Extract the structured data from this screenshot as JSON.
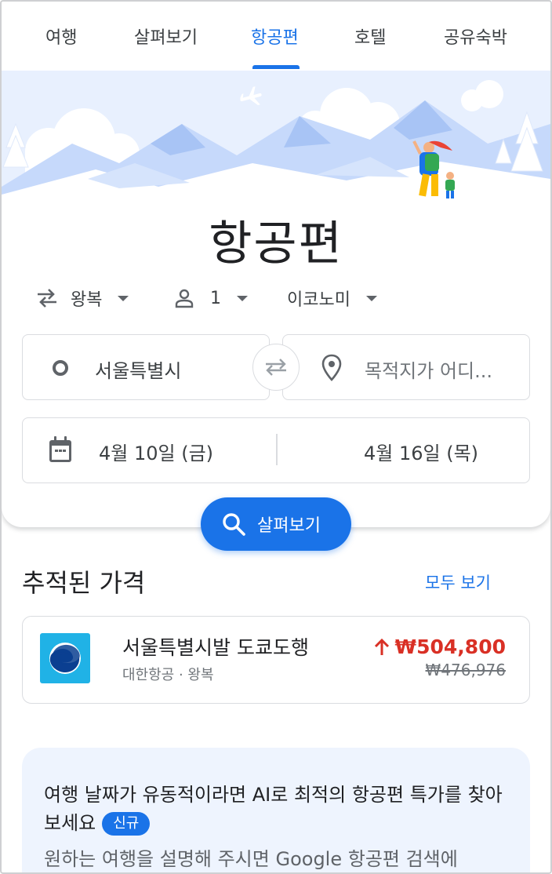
{
  "tabs": [
    {
      "label": "여행"
    },
    {
      "label": "살펴보기"
    },
    {
      "label": "항공편"
    },
    {
      "label": "호텔"
    },
    {
      "label": "공유숙박"
    }
  ],
  "active_tab": "항공편",
  "page_title": "항공편",
  "options": {
    "trip_type": "왕복",
    "passengers": "1",
    "cabin_class": "이코노미"
  },
  "origin": {
    "value": "서울특별시"
  },
  "destination": {
    "placeholder": "목적지가 어디..."
  },
  "dates": {
    "depart": "4월 10일 (금)",
    "return": "4월 16일 (목)"
  },
  "search_button": {
    "label": "살펴보기"
  },
  "tracked": {
    "title": "추적된 가격",
    "see_all": "모두 보기",
    "items": [
      {
        "route": "서울특별시발 도쿄도행",
        "airline": "대한항공 · 왕복",
        "price": "₩504,800",
        "old_price": "₩476,976",
        "trend": "up"
      }
    ]
  },
  "ai_promo": {
    "title": "여행 날짜가 유동적이라면 AI로 최적의 항공편 특가를 찾아보세요",
    "badge": "신규",
    "description": "원하는 여행을 설명해 주시면 Google 항공편 검색에"
  },
  "colors": {
    "accent": "#1a73e8",
    "price_up": "#d93025",
    "airline_logo": "#20b2e6",
    "promo_bg": "#eef4fe"
  },
  "icons": [
    "swap-icon",
    "person-icon",
    "origin-circle-icon",
    "location-pin-icon",
    "swap-arrows-icon",
    "calendar-icon",
    "search-icon",
    "arrow-up-icon",
    "airline-logo",
    "airplane-icon"
  ]
}
